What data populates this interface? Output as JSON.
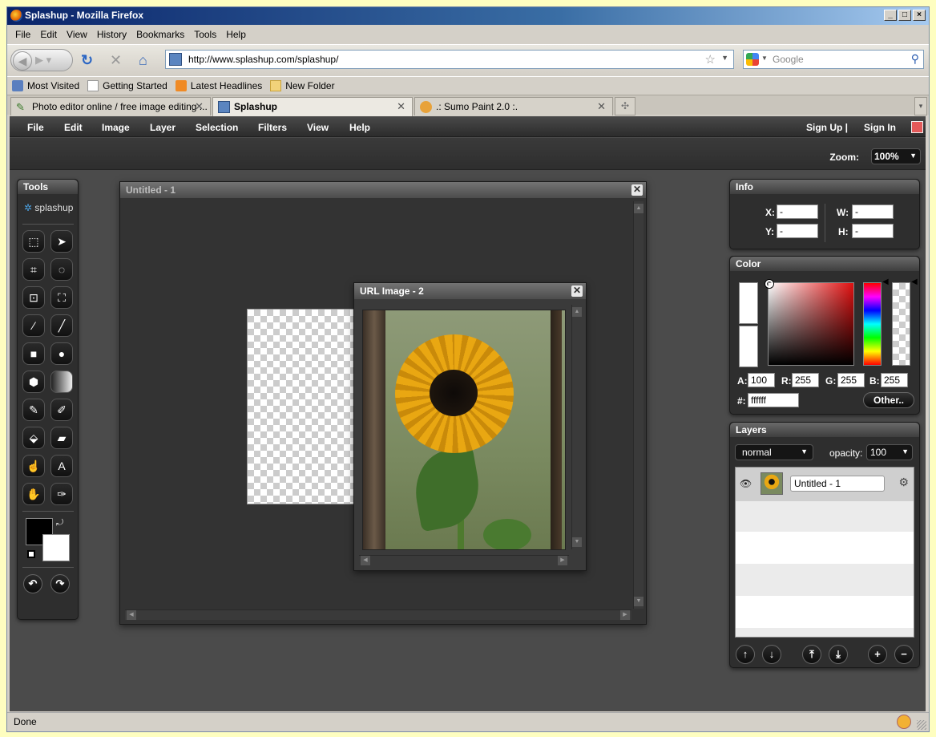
{
  "browser": {
    "title": "Splashup - Mozilla Firefox",
    "menu": [
      "File",
      "Edit",
      "View",
      "History",
      "Bookmarks",
      "Tools",
      "Help"
    ],
    "url": "http://www.splashup.com/splashup/",
    "search_placeholder": "Google",
    "bookmarks": [
      "Most Visited",
      "Getting Started",
      "Latest Headlines",
      "New Folder"
    ],
    "tabs": [
      {
        "label": "Photo editor online / free image editing ..."
      },
      {
        "label": "Splashup"
      },
      {
        "label": ".: Sumo Paint 2.0 :."
      }
    ],
    "status": "Done"
  },
  "app": {
    "menu": [
      "File",
      "Edit",
      "Image",
      "Layer",
      "Selection",
      "Filters",
      "View",
      "Help"
    ],
    "sign_up": "Sign Up |",
    "sign_in": "Sign In",
    "zoom_label": "Zoom:",
    "zoom_value": "100%",
    "tools": {
      "title": "Tools",
      "logo": "splashup"
    },
    "doc1": {
      "title": "Untitled - 1"
    },
    "doc2": {
      "title": "URL Image - 2"
    },
    "info": {
      "title": "Info",
      "x_label": "X:",
      "x_value": "-",
      "y_label": "Y:",
      "y_value": "-",
      "w_label": "W:",
      "w_value": "-",
      "h_label": "H:",
      "h_value": "-"
    },
    "color": {
      "title": "Color",
      "a_label": "A:",
      "a_value": "100",
      "r_label": "R:",
      "r_value": "255",
      "g_label": "G:",
      "g_value": "255",
      "b_label": "B:",
      "b_value": "255",
      "hex_label": "#:",
      "hex_value": "ffffff",
      "other_label": "Other.."
    },
    "layers": {
      "title": "Layers",
      "blend_mode": "normal",
      "opacity_label": "opacity:",
      "opacity_value": "100",
      "items": [
        {
          "name": "Untitled - 1"
        }
      ]
    }
  }
}
